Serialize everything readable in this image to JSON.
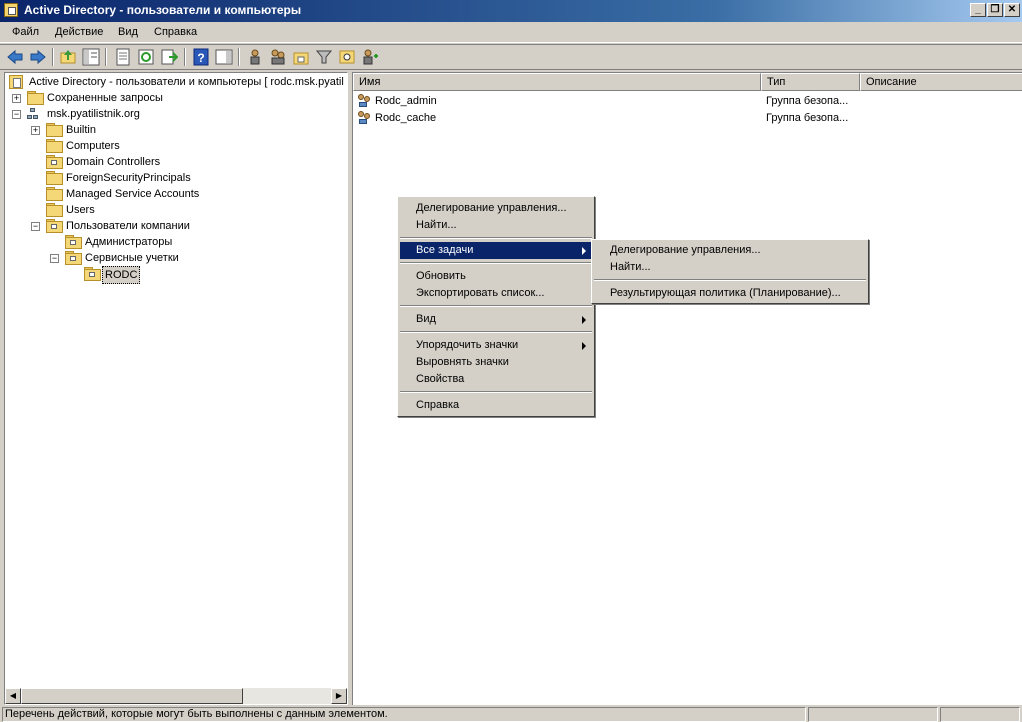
{
  "window": {
    "title": "Active Directory - пользователи и компьютеры",
    "min": "_",
    "restore": "❐",
    "close": "✕"
  },
  "menu": {
    "file": "Файл",
    "action": "Действие",
    "view": "Вид",
    "help": "Справка"
  },
  "toolbar": {
    "icons": [
      "back-icon",
      "forward-icon",
      "up-icon",
      "show-hide-tree-icon",
      "properties-icon",
      "refresh-icon",
      "export-list-icon",
      "help-icon",
      "show-hide-action-pane-icon",
      "new-user-icon",
      "new-group-icon",
      "new-ou-icon",
      "filter-icon",
      "find-icon",
      "add-to-group-icon"
    ]
  },
  "tree": {
    "root": "Active Directory - пользователи и компьютеры [ rodc.msk.pyatil",
    "saved_queries": "Сохраненные запросы",
    "domain": "msk.pyatilistnik.org",
    "builtin": "Builtin",
    "computers": "Computers",
    "domain_controllers": "Domain Controllers",
    "fsp": "ForeignSecurityPrincipals",
    "msa": "Managed Service Accounts",
    "users": "Users",
    "company_users": "Пользователи компании",
    "admins": "Администраторы",
    "service_accounts": "Сервисные учетки",
    "rodc": "RODC",
    "expand_plus": "+",
    "expand_minus": "−"
  },
  "list": {
    "columns": {
      "name": "Имя",
      "type": "Тип",
      "description": "Описание"
    },
    "rows": [
      {
        "name": "Rodc_admin",
        "type": "Группа безопа..."
      },
      {
        "name": "Rodc_cache",
        "type": "Группа безопа..."
      }
    ]
  },
  "context_menu": {
    "delegate": "Делегирование управления...",
    "find": "Найти...",
    "all_tasks": "Все задачи",
    "refresh": "Обновить",
    "export": "Экспортировать список...",
    "view": "Вид",
    "arrange": "Упорядочить значки",
    "line_up": "Выровнять значки",
    "properties": "Свойства",
    "help": "Справка"
  },
  "submenu": {
    "delegate": "Делегирование управления...",
    "find": "Найти...",
    "rsop": "Результирующая политика (Планирование)..."
  },
  "status": {
    "text": "Перечень действий, которые могут быть выполнены с данным элементом."
  }
}
